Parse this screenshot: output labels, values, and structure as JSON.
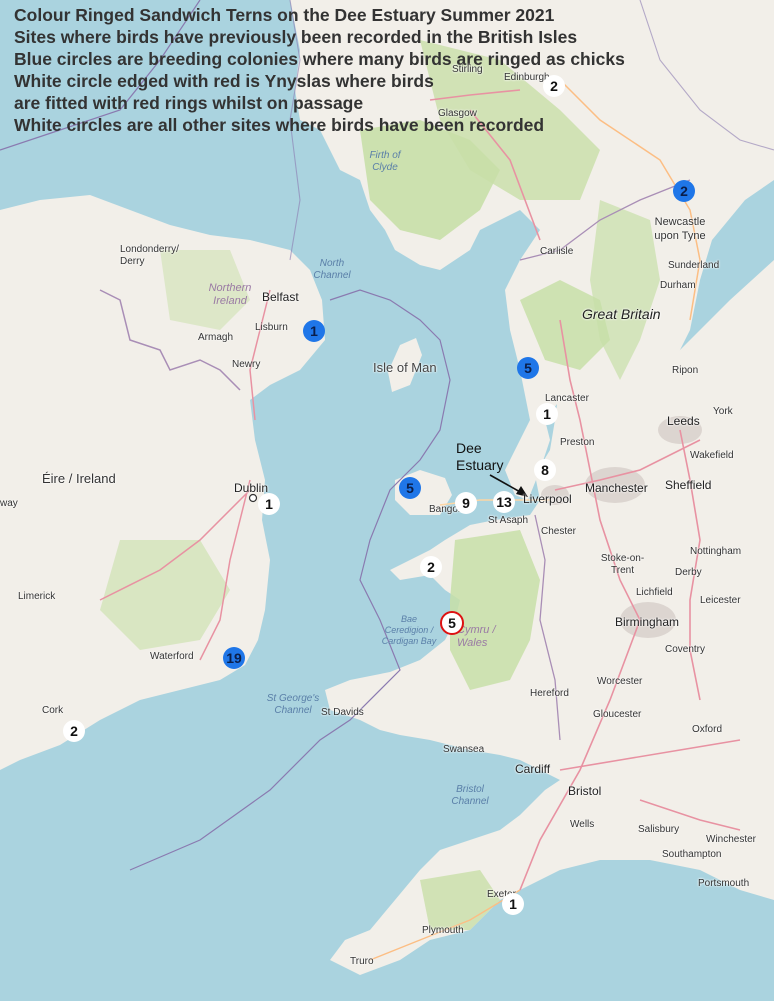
{
  "title_lines": [
    "Colour Ringed Sandwich Terns on the Dee Estuary Summer 2021",
    "Sites where birds have previously been recorded in the British Isles",
    "Blue circles are breeding colonies where many birds are ringed as chicks",
    "White circle edged with red is Ynyslas where birds",
    "are fitted with red rings whilst on passage",
    "White circles are all other sites where birds have been recorded"
  ],
  "annotation": {
    "line1": "Dee",
    "line2": "Estuary"
  },
  "colors": {
    "sea": "#aad3df",
    "land": "#f2efe9",
    "green": "#c8dfa8",
    "blue_marker": "#1f76e8",
    "red_edge": "#dd1111"
  },
  "labels": {
    "stirling": "Stirling",
    "edinburgh": "Edinburgh",
    "glasgow": "Glasgow",
    "firth": "Firth of Clyde",
    "londonderry": "Londonderry/ Derry",
    "north_channel": "North Channel",
    "ni": "Northern Ireland",
    "belfast": "Belfast",
    "lisburn": "Lisburn",
    "armagh": "Armagh",
    "newry": "Newry",
    "newcastle": "Newcastle upon Tyne",
    "sunderland": "Sunderland",
    "durham": "Durham",
    "carlisle": "Carlisle",
    "gb": "Great Britain",
    "iom": "Isle of Man",
    "ripon": "Ripon",
    "lancaster": "Lancaster",
    "york": "York",
    "leeds": "Leeds",
    "preston": "Preston",
    "wakefield": "Wakefield",
    "manchester": "Manchester",
    "sheffield": "Sheffield",
    "liverpool": "Liverpool",
    "bangor": "Bangor",
    "st_asaph": "St Asaph",
    "chester": "Chester",
    "eire": "Éire / Ireland",
    "dublin": "Dublin",
    "way": "way",
    "nottingham": "Nottingham",
    "stoke": "Stoke-on- Trent",
    "derby": "Derby",
    "lichfield": "Lichfield",
    "leicester": "Leicester",
    "limerick": "Limerick",
    "bae": "Bae Ceredigion / Cardigan Bay",
    "cymru": "Cymru / Wales",
    "birmingham": "Birmingham",
    "coventry": "Coventry",
    "waterford": "Waterford",
    "hereford": "Hereford",
    "worcester": "Worcester",
    "st_georges": "St George's Channel",
    "st_davids": "St Davids",
    "cork": "Cork",
    "gloucester": "Gloucester",
    "oxford": "Oxford",
    "swansea": "Swansea",
    "cardiff": "Cardiff",
    "bristol": "Bristol",
    "bristol_channel": "Bristol Channel",
    "wells": "Wells",
    "salisbury": "Salisbury",
    "winchester": "Winchester",
    "southampton": "Southampton",
    "portsmouth": "Portsmouth",
    "exeter": "Exeter",
    "plymouth": "Plymouth",
    "truro": "Truro"
  },
  "markers": [
    {
      "id": "edinburgh",
      "count": "2",
      "kind": "white"
    },
    {
      "id": "coquet",
      "count": "2",
      "kind": "blue"
    },
    {
      "id": "strangford",
      "count": "1",
      "kind": "blue"
    },
    {
      "id": "walney",
      "count": "5",
      "kind": "blue"
    },
    {
      "id": "morecambe",
      "count": "1",
      "kind": "white"
    },
    {
      "id": "hilbre",
      "count": "8",
      "kind": "white"
    },
    {
      "id": "anglesey",
      "count": "5",
      "kind": "blue"
    },
    {
      "id": "dublin",
      "count": "1",
      "kind": "white"
    },
    {
      "id": "penmon",
      "count": "9",
      "kind": "white"
    },
    {
      "id": "colwyn",
      "count": "13",
      "kind": "white"
    },
    {
      "id": "llyn",
      "count": "2",
      "kind": "white"
    },
    {
      "id": "ynyslas",
      "count": "5",
      "kind": "red"
    },
    {
      "id": "wexford",
      "count": "19",
      "kind": "blue"
    },
    {
      "id": "cork",
      "count": "2",
      "kind": "white"
    },
    {
      "id": "exe",
      "count": "1",
      "kind": "white"
    }
  ]
}
